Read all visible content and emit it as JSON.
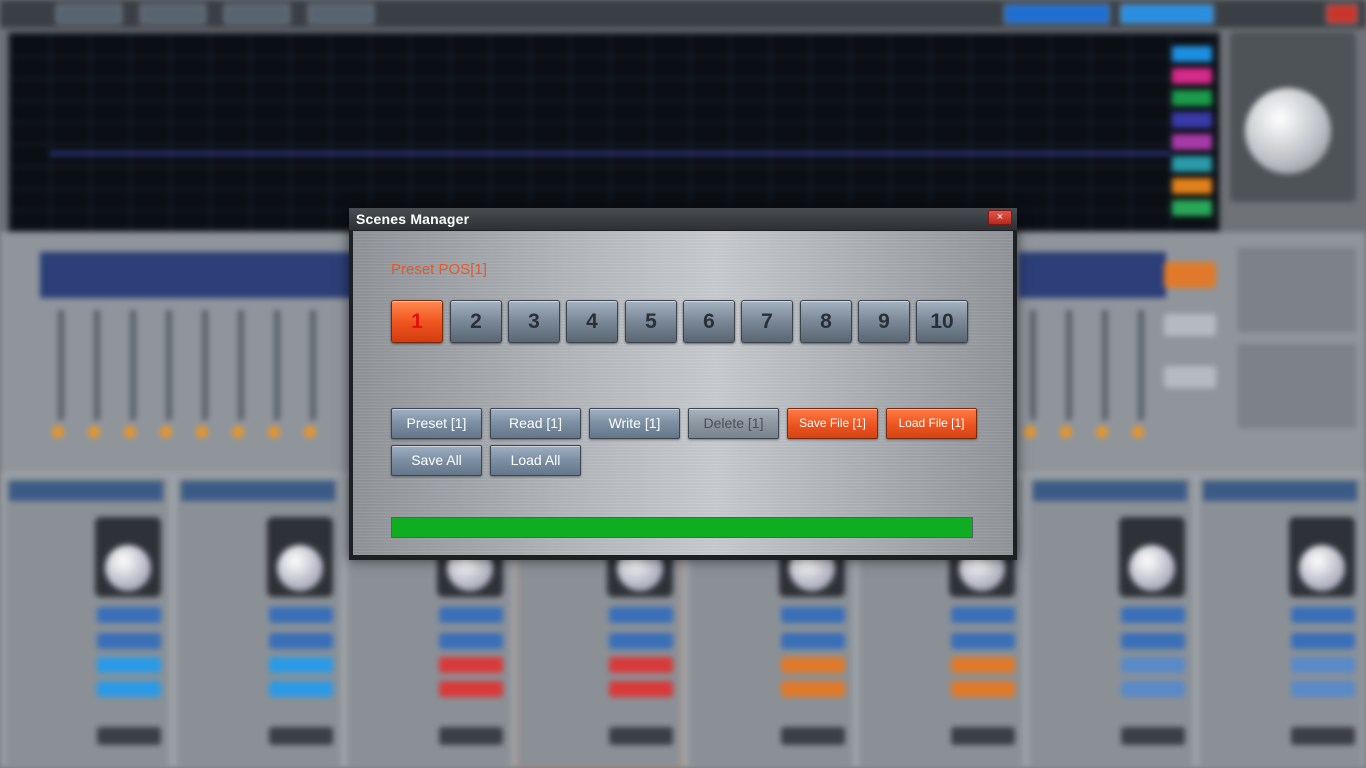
{
  "dialog": {
    "title": "Scenes Manager",
    "close_label": "×",
    "preset_label": "Preset  POS[1]",
    "slots": [
      "1",
      "2",
      "3",
      "4",
      "5",
      "6",
      "7",
      "8",
      "9",
      "10"
    ],
    "active_slot": "1",
    "buttons": {
      "preset": "Preset [1]",
      "read": "Read [1]",
      "write": "Write [1]",
      "delete": "Delete [1]",
      "save_file": "Save File [1]",
      "load_file": "Load File [1]",
      "save_all": "Save All",
      "load_all": "Load All"
    },
    "progress": 1.0
  },
  "colors": {
    "accent_orange": "#ec5420",
    "progress_green": "#0fae22",
    "preset_label": "#e05a2a"
  }
}
